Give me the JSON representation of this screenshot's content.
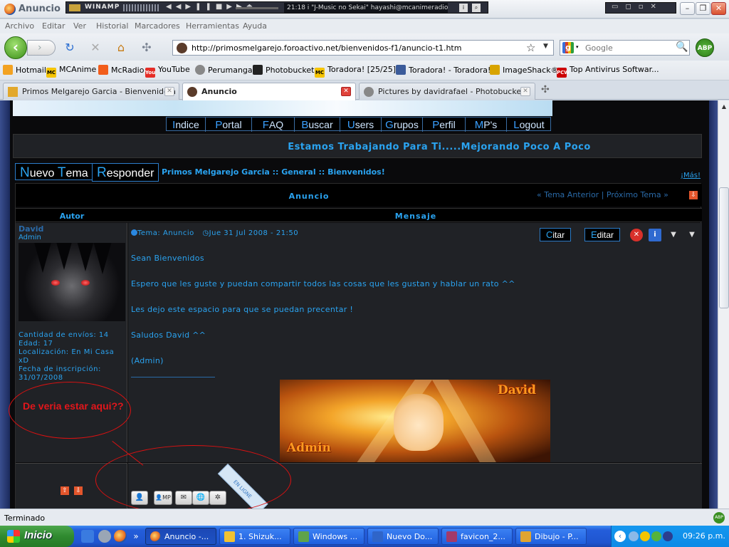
{
  "window": {
    "title": "Anuncio",
    "winamp": {
      "label": "WINAMP",
      "song": "21:18 i \"J-Music no Sekai\" hayashi@mcanimeradio"
    }
  },
  "menubar": [
    "Archivo",
    "Editar",
    "Ver",
    "Historial",
    "Marcadores",
    "Herramientas",
    "Ayuda"
  ],
  "navbar": {
    "url": "http://primosmelgarejo.foroactivo.net/bienvenidos-f1/anuncio-t1.htm",
    "search_placeholder": "Google",
    "abp_label": "ABP"
  },
  "bookmarks": [
    "Hotmail",
    "MCAnime",
    "McRadio",
    "YouTube",
    "Perumanga",
    "Photobucket",
    "Toradora! [25/25]",
    "Toradora! - Toradora!",
    "ImageShack®",
    "Top Antivirus Softwar..."
  ],
  "tabs": [
    {
      "label": "Primos Melgarejo Garcia - Bienvenido a ...",
      "active": false
    },
    {
      "label": "Anuncio",
      "active": true
    },
    {
      "label": "Pictures by davidrafael - Photobucket",
      "active": false
    }
  ],
  "forum": {
    "nav": [
      {
        "first": "I",
        "rest": "ndice"
      },
      {
        "first": "P",
        "rest": "ortal"
      },
      {
        "first": "F",
        "rest": "AQ"
      },
      {
        "first": "B",
        "rest": "uscar"
      },
      {
        "first": "U",
        "rest": "sers"
      },
      {
        "first": "G",
        "rest": "rupos"
      },
      {
        "first": "P",
        "rest": "erfil"
      },
      {
        "first": "M",
        "rest": "P's"
      },
      {
        "first": "L",
        "rest": "ogout"
      }
    ],
    "marquee": "Estamos Trabajando Para Ti.....Mejorando Poco A Poco",
    "new_topic": {
      "first": "N",
      "rest": "uevo ",
      "first2": "T",
      "rest2": "ema"
    },
    "reply": {
      "first": "R",
      "rest": "esponder"
    },
    "breadcrumb": "Primos Melgarejo Garcia :: General :: Bienvenidos!",
    "more_link": "¡Más!",
    "topic_title": "Anuncio",
    "prev_next": "« Tema Anterior | Próximo Tema »",
    "col_author": "Autor",
    "col_message": "Mensaje",
    "author": {
      "name": "David",
      "rank": "Admin",
      "posts": "Cantidad de envíos: 14",
      "age": "Edad: 17",
      "location": "Localización: En Mi Casa xD",
      "registered": "Fecha de inscripción: 31/07/2008"
    },
    "post": {
      "topic_meta": "Tema: Anuncio",
      "date_meta": "Jue 31 Jul 2008 - 21:50",
      "quote": {
        "first": "C",
        "rest": "itar"
      },
      "edit": {
        "first": "E",
        "rest": "ditar"
      },
      "lines": [
        "Sean Bienvenidos",
        "Espero que les guste y puedan compartir todos las cosas que les gustan y hablar un rato ^^",
        "Les dejo este espacio para que se puedan precentar !",
        "Saludos David ^^",
        "(Admin)"
      ],
      "signature": {
        "name": "David",
        "role": "Admin"
      }
    },
    "online_ribbon": "EN LIGNE",
    "annotation": "De veria estar aqui??"
  },
  "status": "Terminado",
  "taskbar": {
    "start": "Inicio",
    "items": [
      "Anuncio -...",
      "1. Shizuk...",
      "Windows ...",
      "Nuevo Do...",
      "favicon_2...",
      "Dibujo - P..."
    ],
    "clock": "09:26 p.m."
  }
}
